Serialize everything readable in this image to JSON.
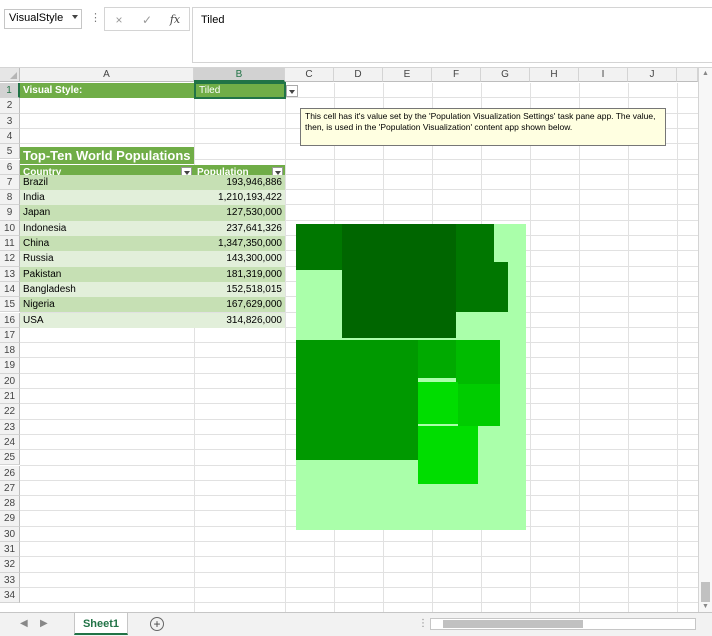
{
  "formula_bar": {
    "name_box": "VisualStyle",
    "cancel_icon": "×",
    "enter_icon": "✓",
    "fx_label": "fx",
    "content": "Tiled"
  },
  "columns": [
    "A",
    "B",
    "C",
    "D",
    "E",
    "F",
    "G",
    "H",
    "I",
    "J"
  ],
  "rows": [
    "1",
    "2",
    "3",
    "4",
    "5",
    "6",
    "7",
    "8",
    "9",
    "10",
    "11",
    "12",
    "13",
    "14",
    "15",
    "16",
    "17",
    "18",
    "19",
    "20",
    "21",
    "22",
    "23",
    "24",
    "25",
    "26",
    "27",
    "28",
    "29",
    "30",
    "31",
    "32",
    "33",
    "34"
  ],
  "sheet": {
    "a1_label": "Visual Style:",
    "b1_value": "Tiled",
    "table_title": "Top-Ten World Populations",
    "header_country": "Country",
    "header_population": "Population",
    "table": [
      {
        "country": "Brazil",
        "population": "193,946,886"
      },
      {
        "country": "India",
        "population": "1,210,193,422"
      },
      {
        "country": "Japan",
        "population": "127,530,000"
      },
      {
        "country": "Indonesia",
        "population": "237,641,326"
      },
      {
        "country": "China",
        "population": "1,347,350,000"
      },
      {
        "country": "Russia",
        "population": "143,300,000"
      },
      {
        "country": "Pakistan",
        "population": "181,319,000"
      },
      {
        "country": "Bangladesh",
        "population": "152,518,015"
      },
      {
        "country": "Nigeria",
        "population": "167,629,000"
      },
      {
        "country": "USA",
        "population": "314,826,000"
      }
    ],
    "comment": "This cell has it's value set by the 'Population Visualization Settings' task pane app. The value, then, is used in the 'Population Visualization' content app shown below."
  },
  "colors": {
    "accent": "#70ad47",
    "selection": "#217346",
    "viz_background": "#aaffaa"
  },
  "tabs": {
    "sheet_name": "Sheet1",
    "add_icon": "+"
  }
}
